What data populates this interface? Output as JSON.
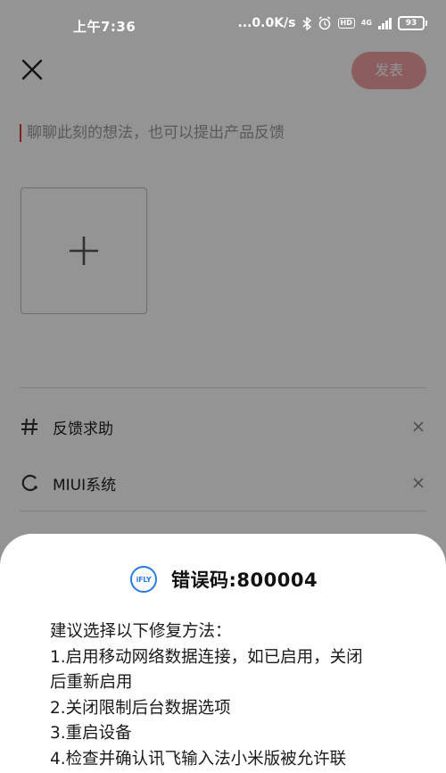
{
  "status_bar": {
    "time": "上午7:36",
    "network_speed": "...0.0K/s",
    "bluetooth_icon": "bluetooth-icon",
    "alarm_icon": "alarm-icon",
    "hd_badge": "HD",
    "signal_label": "4G",
    "battery": "93"
  },
  "header": {
    "close_icon": "close-icon",
    "publish_label": "发表",
    "publish_color": "#f0a0a4"
  },
  "editor": {
    "placeholder": "聊聊此刻的想法，也可以提出产品反馈",
    "caret_color": "#e23a3a"
  },
  "add_image": {
    "icon": "plus-icon"
  },
  "tags": [
    {
      "icon": "hashtag-icon",
      "label": "反馈求助"
    },
    {
      "icon": "miui-loop-icon",
      "label": "MIUI系统"
    }
  ],
  "error_sheet": {
    "logo_text": "iFLY",
    "logo_color": "#2a7be4",
    "title": "错误码:800004",
    "lines": [
      "建议选择以下修复方法：",
      "1.启用移动网络数据连接，如已启用，关闭",
      "后重新启用",
      "2.关闭限制后台数据选项",
      "3.重启设备",
      "4.检查并确认讯飞输入法小米版被允许联"
    ]
  }
}
